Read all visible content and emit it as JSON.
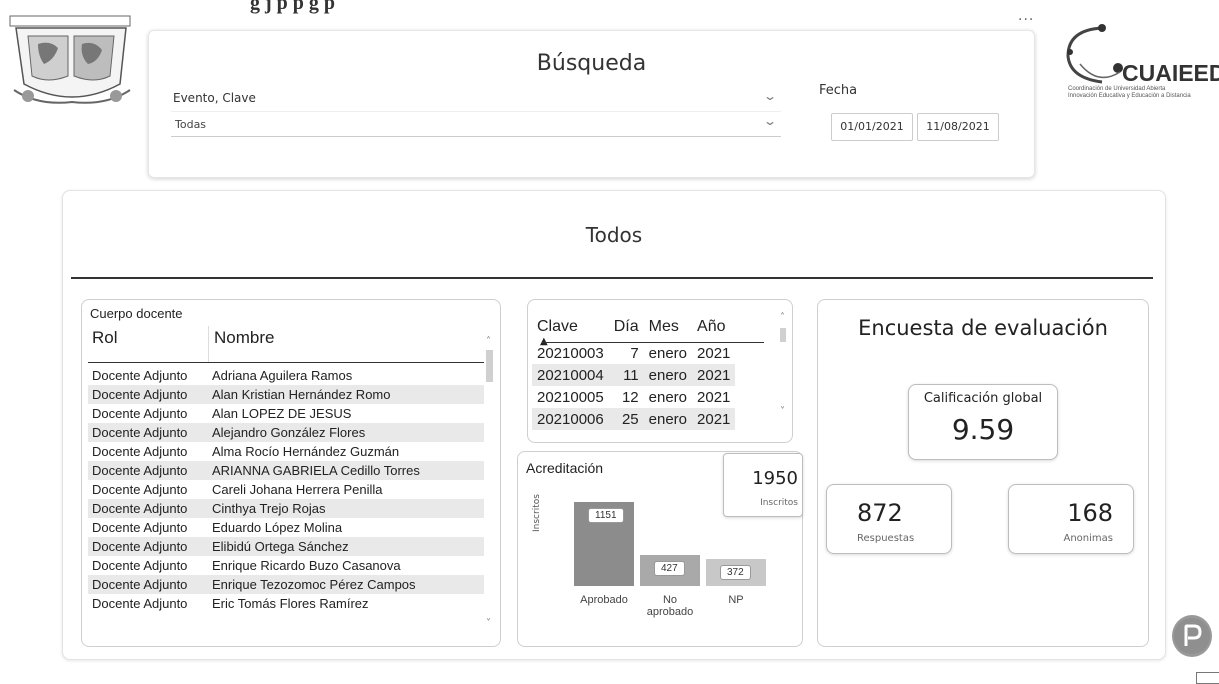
{
  "top_caption": "g      j    p      p  g          p",
  "more_icon": "more-options",
  "logo": {
    "brand": "CUAIEED",
    "line1": "Coordinación de Universidad Abierta",
    "line2": "Innovación Educativa y Educación a Distancia"
  },
  "search": {
    "title": "Búsqueda",
    "evento_label": "Evento, Clave",
    "evento_value": "Todas",
    "fecha_label": "Fecha",
    "fecha_start": "01/01/2021",
    "fecha_end": "11/08/2021"
  },
  "main": {
    "title": "Todos"
  },
  "docentes": {
    "title": "Cuerpo docente",
    "col_rol": "Rol",
    "col_nombre": "Nombre",
    "rows": [
      [
        "Docente Adjunto",
        "Adriana Aguilera Ramos"
      ],
      [
        "Docente Adjunto",
        "Alan Kristian Hernández Romo"
      ],
      [
        "Docente Adjunto",
        "Alan LOPEZ DE JESUS"
      ],
      [
        "Docente Adjunto",
        "Alejandro González Flores"
      ],
      [
        "Docente Adjunto",
        "Alma Rocío Hernández Guzmán"
      ],
      [
        "Docente Adjunto",
        "ARIANNA GABRIELA Cedillo Torres"
      ],
      [
        "Docente Adjunto",
        "Careli Johana Herrera Penilla"
      ],
      [
        "Docente Adjunto",
        "Cinthya Trejo Rojas"
      ],
      [
        "Docente Adjunto",
        "Eduardo López Molina"
      ],
      [
        "Docente Adjunto",
        "Elibidú Ortega Sánchez"
      ],
      [
        "Docente Adjunto",
        "Enrique Ricardo Buzo Casanova"
      ],
      [
        "Docente Adjunto",
        "Enrique Tezozomoc Pérez Campos"
      ],
      [
        "Docente Adjunto",
        "Eric Tomás Flores Ramírez"
      ]
    ]
  },
  "clave": {
    "headers": [
      "Clave",
      "Día",
      "Mes",
      "Año"
    ],
    "rows": [
      [
        "20210003",
        "7",
        "enero",
        "2021"
      ],
      [
        "20210004",
        "11",
        "enero",
        "2021"
      ],
      [
        "20210005",
        "12",
        "enero",
        "2021"
      ],
      [
        "20210006",
        "25",
        "enero",
        "2021"
      ]
    ]
  },
  "acreditacion": {
    "title": "Acreditación",
    "inscritos_value": "1950",
    "inscritos_label": "Inscritos",
    "ylabel": "Inscritos"
  },
  "chart_data": {
    "type": "bar",
    "categories": [
      "Aprobado",
      "No aprobado",
      "NP"
    ],
    "values": [
      1151,
      427,
      372
    ],
    "colors": [
      "#8c8c8c",
      "#a9a9a9",
      "#c8c8c8"
    ],
    "ylabel": "Inscritos"
  },
  "encuesta": {
    "title": "Encuesta de evaluación",
    "global_label": "Calificación global",
    "global_value": "9.59",
    "respuestas_value": "872",
    "respuestas_label": "Respuestas",
    "anonimas_value": "168",
    "anonimas_label": "Anonimas"
  },
  "pbi_icon": "powerbi-icon"
}
